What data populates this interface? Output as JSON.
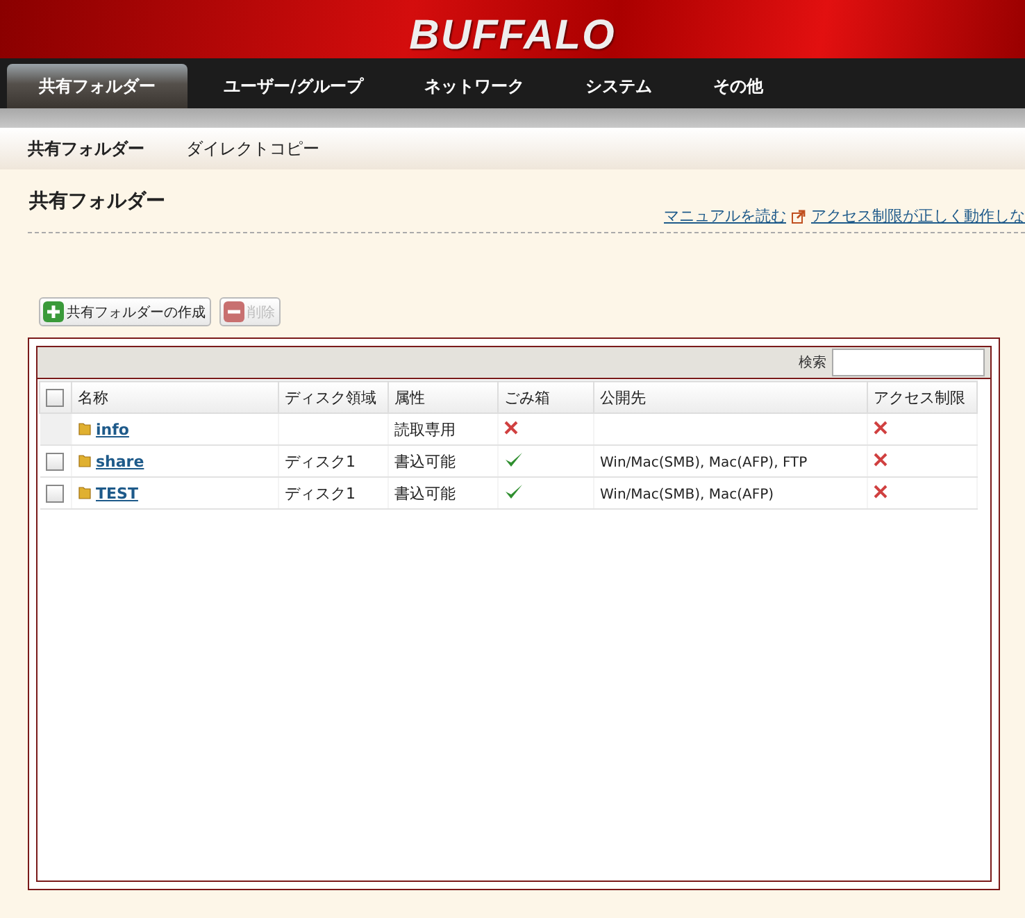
{
  "logo": "BUFFALO",
  "main_tabs": [
    {
      "label": "共有フォルダー",
      "selected": true
    },
    {
      "label": "ユーザー/グループ",
      "selected": false
    },
    {
      "label": "ネットワーク",
      "selected": false
    },
    {
      "label": "システム",
      "selected": false
    },
    {
      "label": "その他",
      "selected": false
    }
  ],
  "sub_tabs": [
    {
      "label": "共有フォルダー",
      "selected": true
    },
    {
      "label": "ダイレクトコピー",
      "selected": false
    }
  ],
  "page_title": "共有フォルダー",
  "links": [
    {
      "label": "マニュアルを読む",
      "external": false
    },
    {
      "label": "アクセス制限が正しく動作しな",
      "external": true
    }
  ],
  "buttons": [
    {
      "kind": "add",
      "label": "共有フォルダーの作成",
      "disabled": false
    },
    {
      "kind": "delete",
      "label": "削除",
      "disabled": true
    }
  ],
  "search": {
    "label": "検索"
  },
  "table": {
    "columns": [
      "名称",
      "ディスク領域",
      "属性",
      "ごみ箱",
      "公開先",
      "アクセス制限"
    ],
    "header_checked": false,
    "rows": [
      {
        "name": "info",
        "selectable": false,
        "disk": "",
        "attribute": "読取専用",
        "trash": false,
        "share_to": "",
        "access_restriction": false
      },
      {
        "name": "share",
        "selectable": true,
        "checked": false,
        "disk": "ディスク1",
        "attribute": "書込可能",
        "trash": true,
        "share_to": "Win/Mac(SMB), Mac(AFP), FTP",
        "access_restriction": false
      },
      {
        "name": "TEST",
        "selectable": true,
        "checked": false,
        "disk": "ディスク1",
        "attribute": "書込可能",
        "trash": true,
        "share_to": "Win/Mac(SMB), Mac(AFP)",
        "access_restriction": false
      }
    ]
  }
}
